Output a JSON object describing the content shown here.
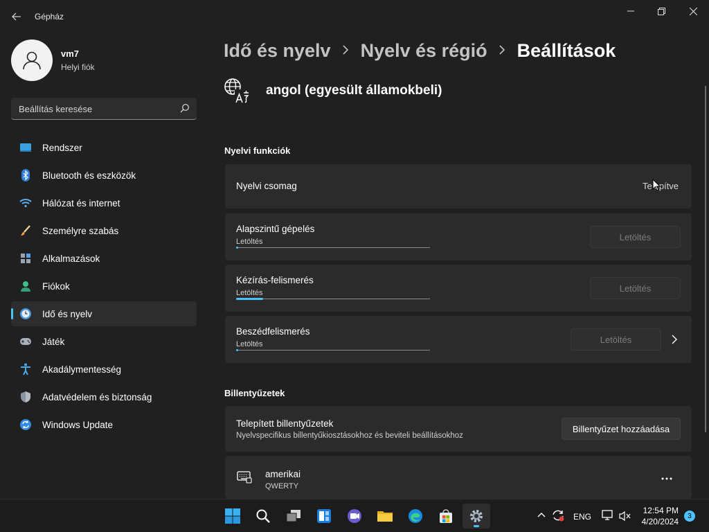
{
  "window": {
    "title": "Gépház"
  },
  "profile": {
    "name": "vm7",
    "account_type": "Helyi fiók"
  },
  "search": {
    "placeholder": "Beállítás keresése"
  },
  "sidebar": {
    "items": [
      {
        "label": "Rendszer",
        "icon": "system-icon"
      },
      {
        "label": "Bluetooth és eszközök",
        "icon": "bluetooth-icon"
      },
      {
        "label": "Hálózat és internet",
        "icon": "wifi-icon"
      },
      {
        "label": "Személyre szabás",
        "icon": "brush-icon"
      },
      {
        "label": "Alkalmazások",
        "icon": "apps-icon"
      },
      {
        "label": "Fiókok",
        "icon": "account-icon"
      },
      {
        "label": "Idő és nyelv",
        "icon": "time-language-icon",
        "selected": true
      },
      {
        "label": "Játék",
        "icon": "gamepad-icon"
      },
      {
        "label": "Akadálymentesség",
        "icon": "accessibility-icon"
      },
      {
        "label": "Adatvédelem és biztonság",
        "icon": "shield-icon"
      },
      {
        "label": "Windows Update",
        "icon": "update-icon"
      }
    ]
  },
  "breadcrumb": {
    "level1": "Idő és nyelv",
    "level2": "Nyelv és régió",
    "current": "Beállítások"
  },
  "language": {
    "title": "angol (egyesült államokbeli)"
  },
  "features": {
    "section_title": "Nyelvi funkciók",
    "language_pack": {
      "label": "Nyelvi csomag",
      "status": "Telepítve"
    },
    "items": [
      {
        "label": "Alapszintű gépelés",
        "sub": "Letöltés",
        "progress": 0.01,
        "button": "Letöltés"
      },
      {
        "label": "Kézírás-felismerés",
        "sub": "Letöltés",
        "progress": 0.14,
        "button": "Letöltés"
      },
      {
        "label": "Beszédfelismerés",
        "sub": "Letöltés",
        "progress": 0.01,
        "button": "Letöltés"
      }
    ]
  },
  "keyboards": {
    "section_title": "Billentyűzetek",
    "installed": {
      "label": "Telepített billentyűzetek",
      "description": "Nyelvspecifikus billentyűkiosztásokhoz és beviteli beállításokhoz",
      "button": "Billentyűzet hozzáadása"
    },
    "list": [
      {
        "name": "amerikai",
        "layout": "QWERTY"
      }
    ]
  },
  "taskbar": {
    "language": "ENG",
    "time": "12:54 PM",
    "date": "4/20/2024",
    "notifications": "3"
  },
  "colors": {
    "accent": "#4cc2ff",
    "background": "#202020",
    "card": "#2b2b2b"
  }
}
